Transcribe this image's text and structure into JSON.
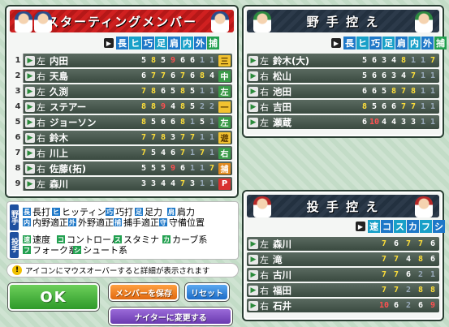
{
  "starting": {
    "title": "スターティングメンバー",
    "headers": [
      "長",
      "ヒ",
      "巧",
      "足",
      "肩",
      "内",
      "外",
      "捕"
    ],
    "rows": [
      {
        "order": "1",
        "hand": "左",
        "name": "内田",
        "vals": [
          "5",
          "8",
          "5",
          "9",
          "6",
          "6",
          "1",
          "1"
        ],
        "pos": "三"
      },
      {
        "order": "2",
        "hand": "右",
        "name": "天島",
        "vals": [
          "6",
          "7",
          "7",
          "6",
          "7",
          "6",
          "8",
          "4"
        ],
        "pos": "中"
      },
      {
        "order": "3",
        "hand": "左",
        "name": "久渕",
        "vals": [
          "7",
          "8",
          "6",
          "5",
          "8",
          "5",
          "1",
          "1"
        ],
        "pos": "左"
      },
      {
        "order": "4",
        "hand": "左",
        "name": "ステアー",
        "vals": [
          "8",
          "8",
          "9",
          "4",
          "8",
          "5",
          "2",
          "2"
        ],
        "pos": "一"
      },
      {
        "order": "5",
        "hand": "右",
        "name": "ジョーソン",
        "vals": [
          "8",
          "5",
          "6",
          "6",
          "8",
          "1",
          "5",
          "1"
        ],
        "pos": "左"
      },
      {
        "order": "6",
        "hand": "右",
        "name": "鈴木",
        "vals": [
          "7",
          "7",
          "8",
          "3",
          "7",
          "7",
          "1",
          "1"
        ],
        "pos": "遊"
      },
      {
        "order": "7",
        "hand": "右",
        "name": "川上",
        "vals": [
          "7",
          "5",
          "4",
          "6",
          "7",
          "1",
          "7",
          "1"
        ],
        "pos": "右"
      },
      {
        "order": "8",
        "hand": "右",
        "name": "佐藤(拓)",
        "vals": [
          "5",
          "5",
          "5",
          "9",
          "6",
          "1",
          "1",
          "7"
        ],
        "pos": "捕"
      },
      {
        "order": "9",
        "hand": "左",
        "name": "森川",
        "vals": [
          "3",
          "3",
          "4",
          "4",
          "7",
          "3",
          "1",
          "1"
        ],
        "pos": "P"
      }
    ]
  },
  "bench": {
    "title": "野 手 控 え",
    "headers": [
      "長",
      "ヒ",
      "巧",
      "足",
      "肩",
      "内",
      "外",
      "捕"
    ],
    "rows": [
      {
        "hand": "左",
        "name": "鈴木(大)",
        "vals": [
          "5",
          "6",
          "3",
          "4",
          "8",
          "1",
          "1",
          "7"
        ]
      },
      {
        "hand": "右",
        "name": "松山",
        "vals": [
          "5",
          "6",
          "6",
          "3",
          "4",
          "7",
          "1",
          "1"
        ]
      },
      {
        "hand": "右",
        "name": "池田",
        "vals": [
          "6",
          "6",
          "5",
          "8",
          "7",
          "8",
          "1",
          "1"
        ]
      },
      {
        "hand": "右",
        "name": "吉田",
        "vals": [
          "8",
          "5",
          "6",
          "6",
          "7",
          "7",
          "1",
          "1"
        ]
      },
      {
        "hand": "左",
        "name": "瀬蔵",
        "vals": [
          "6",
          "10",
          "4",
          "4",
          "3",
          "3",
          "1",
          "1"
        ]
      }
    ]
  },
  "pitchers": {
    "title": "投 手 控 え",
    "headers": [
      "速",
      "コ",
      "ス",
      "カ",
      "フ",
      "シ"
    ],
    "rows": [
      {
        "hand": "左",
        "name": "森川",
        "vals": [
          "",
          "7",
          "6",
          "7",
          "7",
          "6"
        ]
      },
      {
        "hand": "左",
        "name": "滝",
        "vals": [
          "",
          "7",
          "7",
          "4",
          "8",
          "6"
        ]
      },
      {
        "hand": "右",
        "name": "古川",
        "vals": [
          "",
          "7",
          "7",
          "6",
          "2",
          "1"
        ]
      },
      {
        "hand": "右",
        "name": "福田",
        "vals": [
          "",
          "7",
          "7",
          "2",
          "8",
          "8"
        ]
      },
      {
        "hand": "右",
        "name": "石井",
        "vals": [
          "",
          "10",
          "6",
          "2",
          "6",
          "9"
        ]
      }
    ]
  },
  "legend": {
    "fielder_tag": "野手",
    "pitcher_tag": "投手",
    "fielder": [
      {
        "k": "長",
        "t": "長打"
      },
      {
        "k": "ヒ",
        "t": "ヒッティング"
      },
      {
        "k": "巧",
        "t": "巧打"
      },
      {
        "k": "足",
        "t": "足力"
      },
      {
        "k": "肩",
        "t": "肩力"
      },
      {
        "k": "内",
        "t": "内野適正"
      },
      {
        "k": "外",
        "t": "外野適正"
      },
      {
        "k": "捕",
        "t": "捕手適正"
      },
      {
        "k": "守",
        "t": "守備位置"
      }
    ],
    "pitcher": [
      {
        "k": "速",
        "t": "速度"
      },
      {
        "k": "コ",
        "t": "コントロール"
      },
      {
        "k": "ス",
        "t": "スタミナ"
      },
      {
        "k": "カ",
        "t": "カーブ系"
      },
      {
        "k": "フ",
        "t": "フォーク系"
      },
      {
        "k": "シ",
        "t": "シュート系"
      }
    ]
  },
  "info": "アイコンにマウスオーバーすると詳細が表示されます",
  "buttons": {
    "ok": "OK",
    "save": "メンバーを保存",
    "reset": "リセット",
    "night": "ナイターに変更する"
  }
}
